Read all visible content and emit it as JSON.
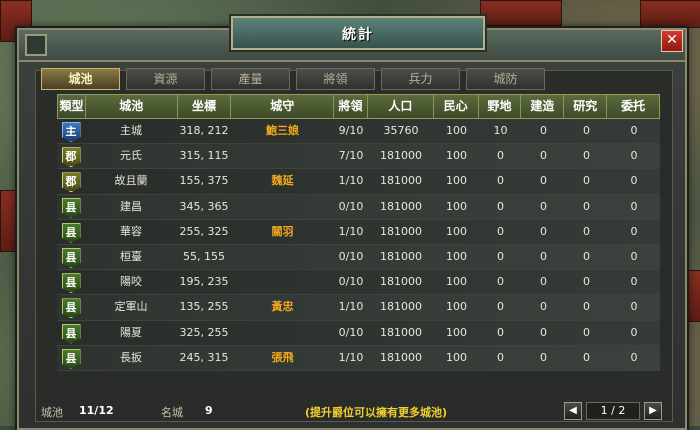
{
  "window": {
    "title": "統計",
    "close_label": "✕"
  },
  "tabs": [
    {
      "label": "城池",
      "active": true
    },
    {
      "label": "資源",
      "active": false
    },
    {
      "label": "產量",
      "active": false
    },
    {
      "label": "將領",
      "active": false
    },
    {
      "label": "兵力",
      "active": false
    },
    {
      "label": "城防",
      "active": false
    }
  ],
  "table": {
    "headers": [
      "類型",
      "城池",
      "坐標",
      "城守",
      "將領",
      "人口",
      "民心",
      "野地",
      "建造",
      "研究",
      "委托"
    ],
    "rows": [
      [
        "主",
        "主城",
        "318, 212",
        "鮑三娘",
        "9/10",
        "35760",
        "100",
        "10",
        "0",
        "0",
        "0"
      ],
      [
        "郡",
        "元氏",
        "315, 115",
        "",
        "7/10",
        "181000",
        "100",
        "0",
        "0",
        "0",
        "0"
      ],
      [
        "郡",
        "故且蘭",
        "155, 375",
        "魏延",
        "1/10",
        "181000",
        "100",
        "0",
        "0",
        "0",
        "0"
      ],
      [
        "县",
        "建昌",
        "345, 365",
        "",
        "0/10",
        "181000",
        "100",
        "0",
        "0",
        "0",
        "0"
      ],
      [
        "县",
        "華容",
        "255, 325",
        "關羽",
        "1/10",
        "181000",
        "100",
        "0",
        "0",
        "0",
        "0"
      ],
      [
        "县",
        "桓臺",
        "55, 155",
        "",
        "0/10",
        "181000",
        "100",
        "0",
        "0",
        "0",
        "0"
      ],
      [
        "县",
        "陽咬",
        "195, 235",
        "",
        "0/10",
        "181000",
        "100",
        "0",
        "0",
        "0",
        "0"
      ],
      [
        "县",
        "定軍山",
        "135, 255",
        "黃忠",
        "1/10",
        "181000",
        "100",
        "0",
        "0",
        "0",
        "0"
      ],
      [
        "县",
        "陽夏",
        "325, 255",
        "",
        "0/10",
        "181000",
        "100",
        "0",
        "0",
        "0",
        "0"
      ],
      [
        "县",
        "長扳",
        "245, 315",
        "張飛",
        "1/10",
        "181000",
        "100",
        "0",
        "0",
        "0",
        "0"
      ]
    ]
  },
  "footer": {
    "cities_label": "城池",
    "cities_value": "11/12",
    "famous_label": "名城",
    "famous_value": "9",
    "hint": "(提升爵位可以擁有更多城池)",
    "page": "1 / 2",
    "prev_icon": "◀",
    "next_icon": "▶"
  }
}
